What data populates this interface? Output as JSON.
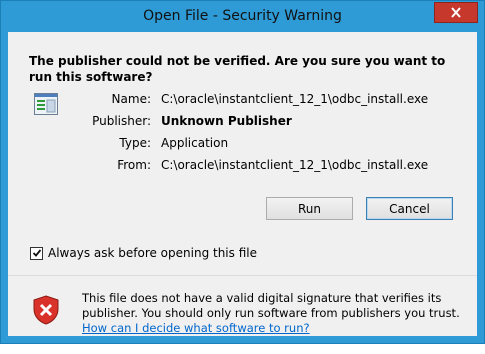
{
  "window": {
    "title": "Open File - Security Warning",
    "accent": "#2e9bd6"
  },
  "question": "The publisher could not be verified.  Are you sure you want to run this software?",
  "details": [
    {
      "label": "Name:",
      "value": "C:\\oracle\\instantclient_12_1\\odbc_install.exe",
      "bold": false
    },
    {
      "label": "Publisher:",
      "value": "Unknown Publisher",
      "bold": true
    },
    {
      "label": "Type:",
      "value": "Application",
      "bold": false
    },
    {
      "label": "From:",
      "value": "C:\\oracle\\instantclient_12_1\\odbc_install.exe",
      "bold": false
    }
  ],
  "buttons": {
    "run": "Run",
    "cancel": "Cancel"
  },
  "checkbox": {
    "label": "Always ask before opening this file",
    "checked": true
  },
  "footer": {
    "warning": "This file does not have a valid digital signature that verifies its publisher.  You should only run software from publishers you trust.",
    "link": "How can I decide what software to run?"
  },
  "icons": {
    "close": "close-icon",
    "app": "application-icon",
    "shield": "warning-shield-icon"
  }
}
